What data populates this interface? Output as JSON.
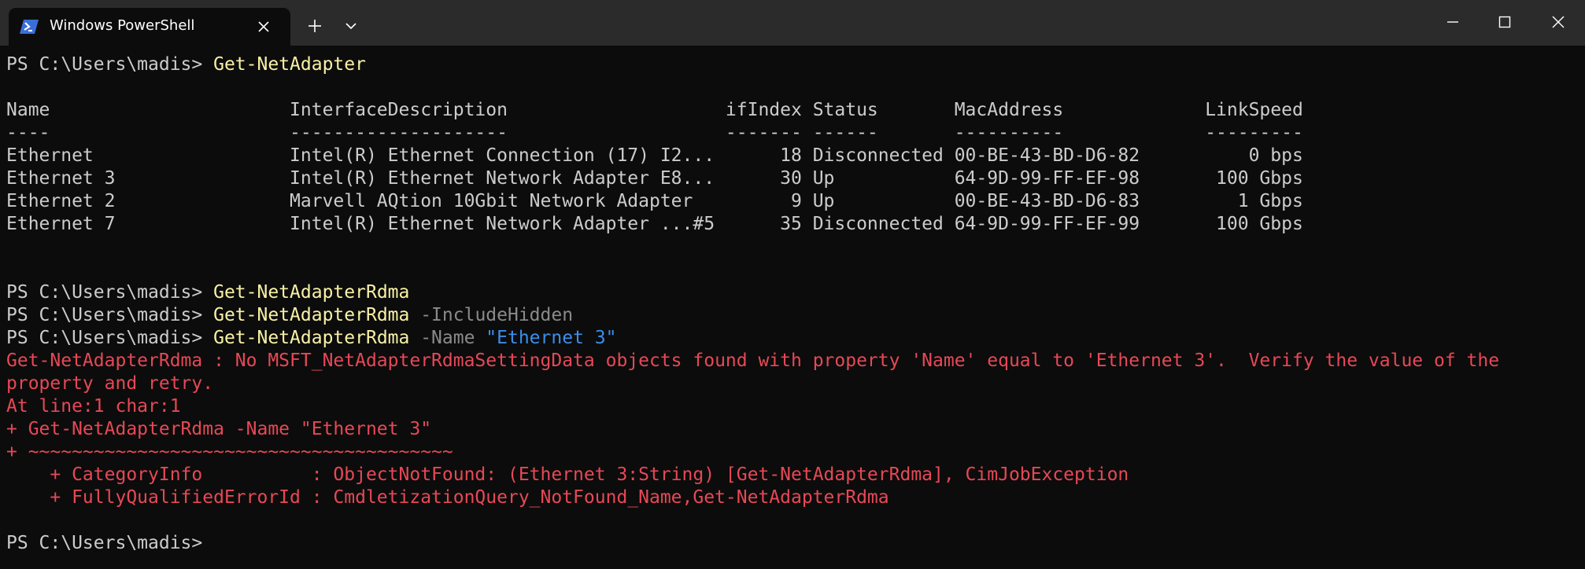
{
  "window": {
    "tab_title": "Windows PowerShell",
    "accent_color": "#3a6fd8"
  },
  "prompt": "PS C:\\Users\\madis> ",
  "terminal": {
    "cmd1": "Get-NetAdapter",
    "table_header": "Name                      InterfaceDescription                    ifIndex Status       MacAddress             LinkSpeed",
    "table_rule": "----                      --------------------                    ------- ------       ----------             ---------",
    "table_rows": [
      "Ethernet                  Intel(R) Ethernet Connection (17) I2...      18 Disconnected 00-BE-43-BD-D6-82          0 bps",
      "Ethernet 3                Intel(R) Ethernet Network Adapter E8...      30 Up           64-9D-99-FF-EF-98       100 Gbps",
      "Ethernet 2                Marvell AQtion 10Gbit Network Adapter         9 Up           00-BE-43-BD-D6-83         1 Gbps",
      "Ethernet 7                Intel(R) Ethernet Network Adapter ...#5      35 Disconnected 64-9D-99-FF-EF-99       100 Gbps"
    ],
    "cmd2": "Get-NetAdapterRdma",
    "cmd3": "Get-NetAdapterRdma",
    "cmd3_param": " -IncludeHidden",
    "cmd4": "Get-NetAdapterRdma",
    "cmd4_param": " -Name ",
    "cmd4_string": "\"Ethernet 3\"",
    "error_lines": [
      "Get-NetAdapterRdma : No MSFT_NetAdapterRdmaSettingData objects found with property 'Name' equal to 'Ethernet 3'.  Verify the value of the",
      "property and retry.",
      "At line:1 char:1",
      "+ Get-NetAdapterRdma -Name \"Ethernet 3\"",
      "+ ~~~~~~~~~~~~~~~~~~~~~~~~~~~~~~~~~~~~~~~",
      "    + CategoryInfo          : ObjectNotFound: (Ethernet 3:String) [Get-NetAdapterRdma], CimJobException",
      "    + FullyQualifiedErrorId : CmdletizationQuery_NotFound_Name,Get-NetAdapterRdma"
    ]
  }
}
